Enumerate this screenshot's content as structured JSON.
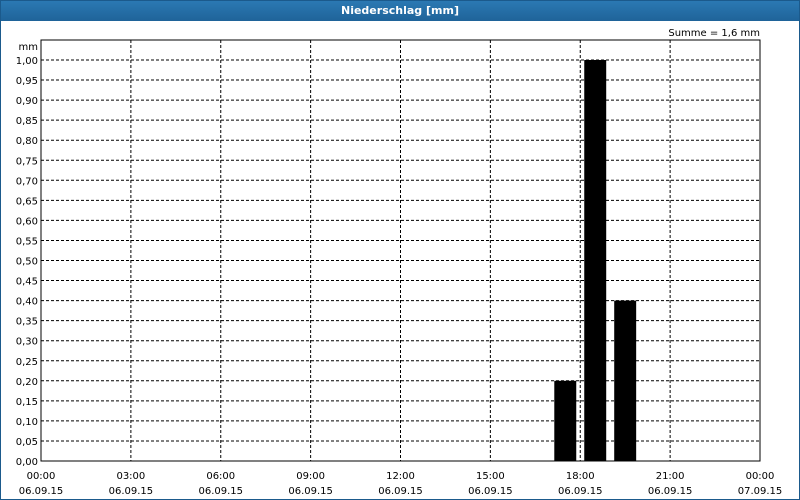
{
  "window": {
    "title": "Niederschlag [mm]"
  },
  "chart_data": {
    "type": "bar",
    "unit_label": "mm",
    "summary": "Summe = 1,6 mm",
    "ylim": [
      0,
      1.0
    ],
    "y_ticks": [
      "0,00",
      "0,05",
      "0,10",
      "0,15",
      "0,20",
      "0,25",
      "0,30",
      "0,35",
      "0,40",
      "0,45",
      "0,50",
      "0,55",
      "0,60",
      "0,65",
      "0,70",
      "0,75",
      "0,80",
      "0,85",
      "0,90",
      "0,95",
      "1,00"
    ],
    "x_ticks": [
      {
        "time": "00:00",
        "date": "06.09.15"
      },
      {
        "time": "03:00",
        "date": "06.09.15"
      },
      {
        "time": "06:00",
        "date": "06.09.15"
      },
      {
        "time": "09:00",
        "date": "06.09.15"
      },
      {
        "time": "12:00",
        "date": "06.09.15"
      },
      {
        "time": "15:00",
        "date": "06.09.15"
      },
      {
        "time": "18:00",
        "date": "06.09.15"
      },
      {
        "time": "21:00",
        "date": "06.09.15"
      },
      {
        "time": "00:00",
        "date": "07.09.15"
      }
    ],
    "grid": true,
    "bar_color": "#000000",
    "series": [
      {
        "values": [
          {
            "time": "17:00–18:00",
            "value": 0.2
          },
          {
            "time": "18:00–19:00",
            "value": 1.0
          },
          {
            "time": "19:00–20:00",
            "value": 0.4
          }
        ]
      }
    ]
  }
}
